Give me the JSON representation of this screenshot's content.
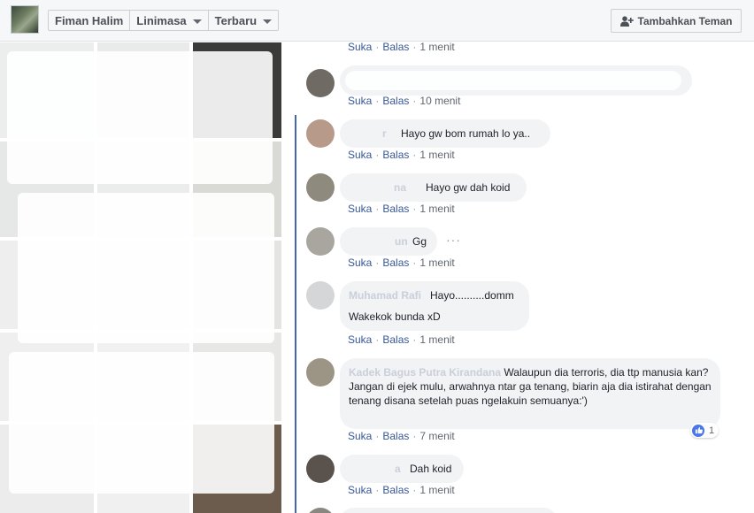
{
  "header": {
    "crumbs": [
      "Fiman Halim",
      "Linimasa",
      "Terbaru"
    ],
    "add_friend_label": "Tambahkan Teman",
    "add_friend_icon": "add-friend-icon"
  },
  "actions": {
    "like": "Suka",
    "reply": "Balas"
  },
  "comments": [
    {
      "time": "1 menit"
    },
    {
      "time": "10 menit"
    },
    {
      "name": "r",
      "text": "Hayo gw bom rumah lo ya..",
      "time": "1 menit"
    },
    {
      "name": "na",
      "text": "Hayo gw dah koid",
      "time": "1 menit"
    },
    {
      "name": "un",
      "text": "Gg",
      "time": "1 menit"
    },
    {
      "name": "Muhamad Rafi",
      "text": "Hayo..........domm",
      "text2": "Wakekok bunda xD",
      "time": "1 menit"
    },
    {
      "name": "Kadek Bagus Putra Kirandana",
      "text": "Walaupun dia terroris, dia ttp manusia kan? Jangan di ejek mulu, arwahnya ntar ga tenang, biarin aja dia istirahat dengan tenang disana setelah puas ngelakuin semuanya:')",
      "time": "7 menit",
      "likes": "1"
    },
    {
      "name": "a",
      "text": "Dah koid",
      "time": "1 menit"
    }
  ],
  "colors": {
    "link": "#385898",
    "thread": "#4267b2",
    "bubble": "#f2f3f5"
  }
}
